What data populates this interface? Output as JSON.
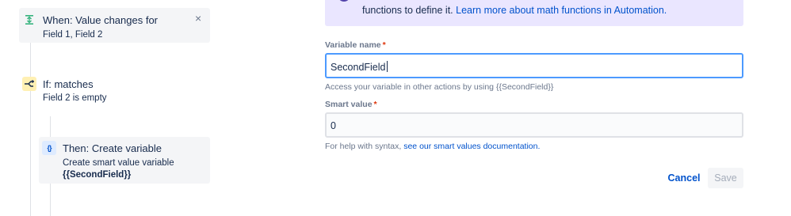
{
  "rule": {
    "trigger": {
      "icon": "trigger-icon",
      "title": "When: Value changes for",
      "fields": "Field 1, Field 2",
      "close_label": "×"
    },
    "condition": {
      "icon": "branch-condition-icon",
      "title": "If: matches",
      "detail": "Field 2 is empty"
    },
    "action": {
      "icon": "braces-icon",
      "icon_text": "{}",
      "title": "Then: Create variable",
      "detail": "Create smart value variable",
      "variable": "{{SecondField}}"
    }
  },
  "form": {
    "info": {
      "text": "functions to define it.",
      "link": "Learn more about math functions in Automation."
    },
    "variable_name": {
      "label": "Variable name",
      "required_mark": "*",
      "value": "SecondField",
      "help": "Access your variable in other actions by using {{SecondField}}"
    },
    "smart_value": {
      "label": "Smart value",
      "required_mark": "*",
      "value": "0",
      "help_prefix": "For help with syntax,",
      "help_link": "see our smart values documentation."
    },
    "buttons": {
      "cancel": "Cancel",
      "save": "Save"
    }
  },
  "colors": {
    "accent": "#0052cc",
    "focus_border": "#4c9aff",
    "info_bg": "#eae6ff",
    "required": "#de350b",
    "condition_icon_bg": "#fff0b3",
    "action_icon_bg": "#deebff",
    "trigger_icon": "#36b37e"
  }
}
